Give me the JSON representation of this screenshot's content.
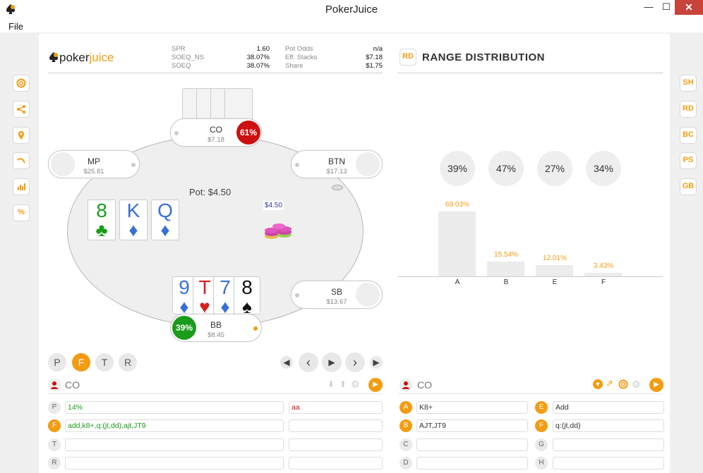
{
  "window": {
    "title": "PokerJuice",
    "min": "—",
    "max": "☐",
    "close": "✕"
  },
  "menu": {
    "file": "File"
  },
  "left_toolbar": [
    "lifebuoy-icon",
    "share-icon",
    "pin-icon",
    "arc-icon",
    "bar-chart-icon",
    "percent-icon"
  ],
  "right_toolbar": [
    "SH",
    "RD",
    "BC",
    "PS",
    "GB"
  ],
  "logo": {
    "part1": "poker",
    "part2": "juice"
  },
  "stats": {
    "left": [
      {
        "label": "SPR",
        "value": "1.60"
      },
      {
        "label": "SOEQ_NS",
        "value": "38.07%"
      },
      {
        "label": "SOEQ",
        "value": "38.07%"
      }
    ],
    "right": [
      {
        "label": "Pot Odds",
        "value": "n/a"
      },
      {
        "label": "Eff. Stacks",
        "value": "$7.18"
      },
      {
        "label": "Share",
        "value": "$1.75"
      }
    ]
  },
  "seats": {
    "co": {
      "name": "CO",
      "stack": "$7.18",
      "pct": "61%"
    },
    "mp": {
      "name": "MP",
      "stack": "$25.81"
    },
    "btn": {
      "name": "BTN",
      "stack": "$17.13"
    },
    "sb": {
      "name": "SB",
      "stack": "$13.67"
    },
    "bb": {
      "name": "BB",
      "stack": "$8.45",
      "pct": "39%"
    }
  },
  "pot": {
    "label": "Pot: $4.50",
    "chip_amount": "$4.50"
  },
  "board": [
    {
      "rank": "8",
      "suit": "♣",
      "color": "#1a9b1a"
    },
    {
      "rank": "K",
      "suit": "♦",
      "color": "#3a6fd6"
    },
    {
      "rank": "Q",
      "suit": "♦",
      "color": "#3a6fd6"
    }
  ],
  "hand": [
    {
      "rank": "9",
      "suit": "♦",
      "color": "#3a6fd6"
    },
    {
      "rank": "T",
      "suit": "♥",
      "color": "#d62020"
    },
    {
      "rank": "7",
      "suit": "♦",
      "color": "#3a6fd6"
    },
    {
      "rank": "8",
      "suit": "♠",
      "color": "#111"
    }
  ],
  "streets": [
    "P",
    "F",
    "T",
    "R"
  ],
  "range_distribution": {
    "badge": "RD",
    "title": "RANGE DISTRIBUTION",
    "circles": [
      "39%",
      "47%",
      "27%",
      "34%"
    ]
  },
  "chart_data": {
    "type": "bar",
    "categories": [
      "A",
      "B",
      "E",
      "F"
    ],
    "values": [
      69.03,
      15.54,
      12.01,
      3.43
    ],
    "labels": [
      "69.03%",
      "15.54%",
      "12.01%",
      "3.43%"
    ]
  },
  "left_panel": {
    "player": "CO",
    "rows": [
      {
        "label": "P",
        "a": "14%",
        "b": "aa"
      },
      {
        "label": "F",
        "a": "add,k8+,q:(jt,dd),ajt,JT9",
        "b": ""
      },
      {
        "label": "T",
        "a": "",
        "b": ""
      },
      {
        "label": "R",
        "a": "",
        "b": ""
      }
    ]
  },
  "right_panel": {
    "player": "CO",
    "rows": [
      {
        "l1": "A",
        "v1": "K8+",
        "l2": "E",
        "v2": "Add"
      },
      {
        "l1": "B",
        "v1": "AJT,JT9",
        "l2": "F",
        "v2": "q:(jt,dd)"
      },
      {
        "l1": "C",
        "v1": "",
        "l2": "G",
        "v2": ""
      },
      {
        "l1": "D",
        "v1": "",
        "l2": "H",
        "v2": ""
      }
    ]
  },
  "colors": {
    "accent": "#f39c12",
    "red_badge": "#cc1111",
    "green_badge": "#1a9b1a"
  }
}
